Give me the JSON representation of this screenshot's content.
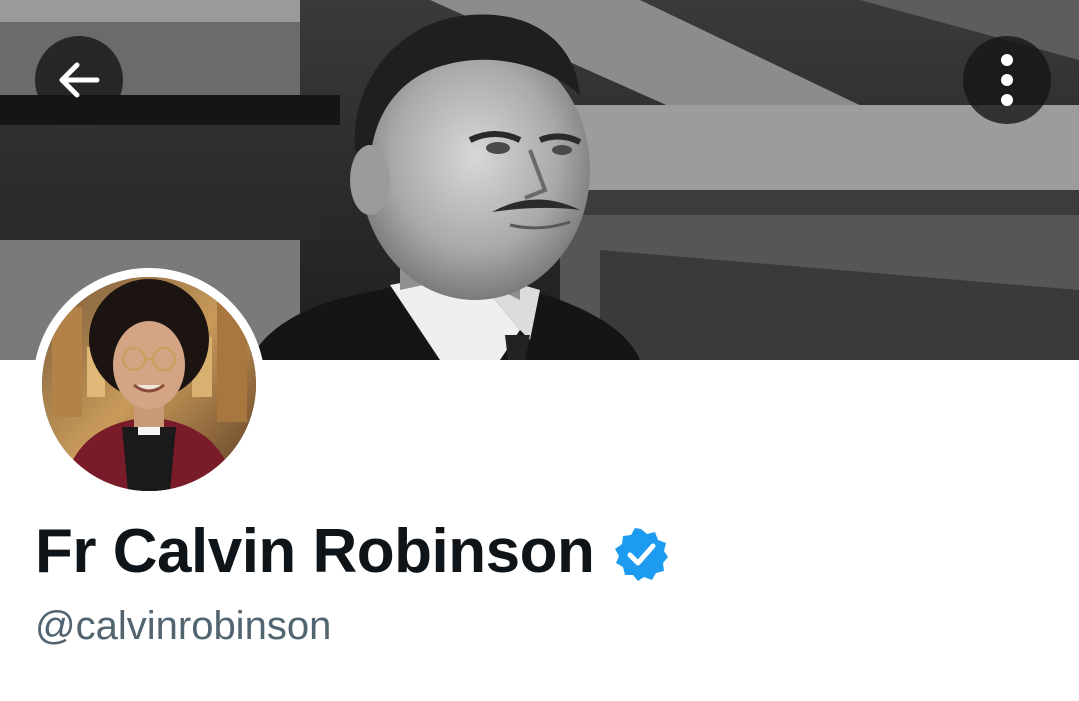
{
  "profile": {
    "display_name": "Fr Calvin Robinson",
    "handle": "@calvinrobinson",
    "verified": true
  },
  "header": {
    "back_icon": "arrow-left-icon",
    "more_icon": "more-vertical-icon"
  },
  "colors": {
    "name": "#0f1419",
    "handle": "#536471",
    "verified_badge": "#1d9bf0",
    "button_bg": "#141414"
  }
}
